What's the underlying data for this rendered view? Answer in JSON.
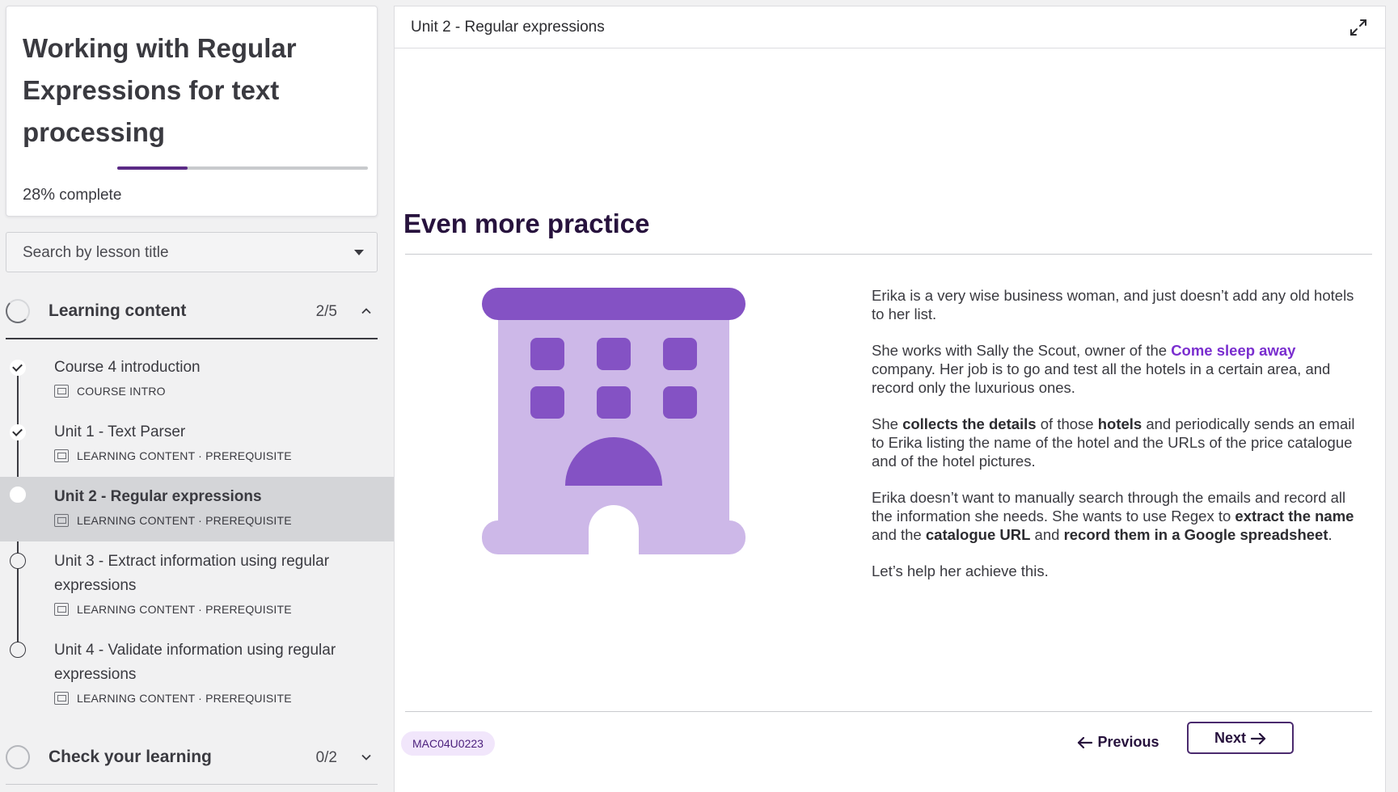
{
  "course": {
    "title": "Working with Regular Expressions for text processing",
    "progress_percent": 28,
    "progress_pct_label": "28%",
    "progress_suffix": " complete"
  },
  "search": {
    "placeholder": "Search by lesson title"
  },
  "sections": [
    {
      "label": "Learning content",
      "count": "2/5",
      "expanded": true
    },
    {
      "label": "Check your learning",
      "count": "0/2",
      "expanded": false
    }
  ],
  "lessons": [
    {
      "title": "Course 4 introduction",
      "meta": "COURSE INTRO",
      "status": "done"
    },
    {
      "title": "Unit 1 - Text Parser",
      "meta": "LEARNING CONTENT · PREREQUISITE",
      "status": "done"
    },
    {
      "title": "Unit 2 - Regular expressions",
      "meta": "LEARNING CONTENT · PREREQUISITE",
      "status": "current"
    },
    {
      "title": "Unit 3 - Extract information using regular expressions",
      "meta": "LEARNING CONTENT · PREREQUISITE",
      "status": "todo"
    },
    {
      "title": "Unit 4 - Validate information using regular expressions",
      "meta": "LEARNING CONTENT · PREREQUISITE",
      "status": "todo"
    }
  ],
  "main": {
    "topbar_title": "Unit 2 - Regular expressions",
    "heading": "Even more practice",
    "paragraphs": {
      "p1": "Erika is a very wise business woman, and just doesn’t add any old hotels to her list.",
      "p2_a": "She works with Sally the Scout, owner of the ",
      "p2_link": "Come sleep away",
      "p2_b": " company. Her job is to go and test all the hotels in a certain area, and record only the luxurious ones.",
      "p3_a": "She ",
      "p3_b1": "collects the details",
      "p3_c": " of those ",
      "p3_b2": "hotels",
      "p3_d": " and periodically sends an email to Erika listing the name of the hotel and the URLs of the price catalogue and of the hotel pictures.",
      "p4_a": "Erika doesn’t want to manually search through the emails and record all the information she needs. She wants to use Regex to ",
      "p4_b1": "extract the name",
      "p4_c": " and the ",
      "p4_b2": "catalogue URL",
      "p4_d": " and ",
      "p4_b3": "record them in a Google spreadsheet",
      "p4_e": ".",
      "p5": "Let’s help her achieve this."
    },
    "code": "MAC04U0223",
    "prev_label": "Previous",
    "next_label": "Next"
  },
  "icons": {
    "expand": "expand-icon",
    "illustration": "hotel-building-illustration",
    "caret": "caret-down-icon"
  },
  "colors": {
    "heading": "#27123d",
    "link": "#7a2ecf",
    "illustration_dark": "#8452c4",
    "illustration_light": "#cdb8e8",
    "code_tag_bg": "#f1e6fb",
    "active_row": "#d4d5d8"
  }
}
